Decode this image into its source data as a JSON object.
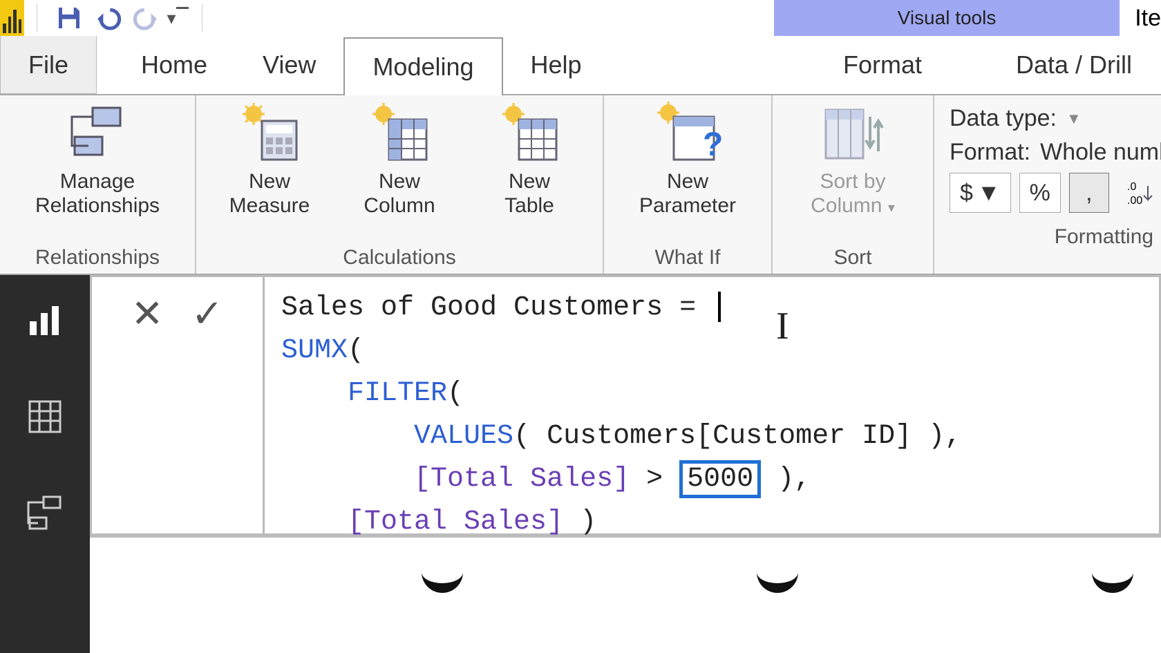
{
  "qat": {
    "save": "save",
    "undo": "undo",
    "redo": "redo"
  },
  "contextual_tab": "Visual tools",
  "truncated_right": "Ite",
  "tabs": {
    "file": "File",
    "items": [
      "Home",
      "View",
      "Modeling",
      "Help"
    ],
    "active_index": 2,
    "contextual": [
      "Format",
      "Data / Drill"
    ]
  },
  "ribbon": {
    "groups": [
      {
        "label": "Relationships",
        "items": [
          {
            "label1": "Manage",
            "label2": "Relationships"
          }
        ]
      },
      {
        "label": "Calculations",
        "items": [
          {
            "label1": "New",
            "label2": "Measure"
          },
          {
            "label1": "New",
            "label2": "Column"
          },
          {
            "label1": "New",
            "label2": "Table"
          }
        ]
      },
      {
        "label": "What If",
        "items": [
          {
            "label1": "New",
            "label2": "Parameter"
          }
        ]
      },
      {
        "label": "Sort",
        "items": [
          {
            "label1": "Sort by",
            "label2": "Column",
            "dropdown": true,
            "disabled": true
          }
        ]
      }
    ],
    "formatting": {
      "data_type_label": "Data type:",
      "format_label": "Format:",
      "format_value": "Whole number",
      "currency": "$",
      "percent": "%",
      "thousand": ",",
      "decimal_icon": ".00",
      "decimals_value": "0",
      "group_label": "Formatting"
    }
  },
  "rail": {
    "report": "report-view",
    "data": "data-view",
    "model": "model-view"
  },
  "formula": {
    "cancel": "✕",
    "commit": "✓",
    "measure_name": "Sales of Good Customers",
    "eq": " = ",
    "fn_sumx": "SUMX",
    "fn_filter": "FILTER",
    "fn_values": "VALUES",
    "tbl_col": "Customers[Customer ID]",
    "total_sales": "[Total Sales]",
    "gt": ">",
    "threshold": "5000"
  },
  "background_word": "Iter"
}
